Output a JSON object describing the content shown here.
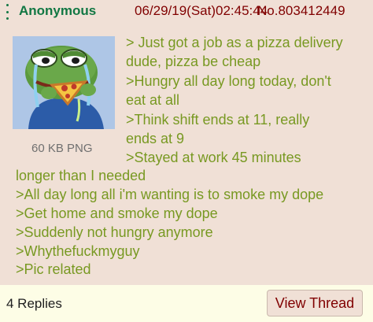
{
  "post": {
    "name": "Anonymous",
    "datetime": "06/29/19(Sat)02:45:44",
    "post_number": "No.803412449",
    "file_info": "60 KB PNG",
    "lines": [
      "> Just got a job as a pizza delivery",
      "dude, pizza be cheap",
      ">Hungry all day long today, don't",
      "eat at all",
      ">Think shift ends at 11, really",
      "ends at 9",
      ">Stayed at work 45 minutes",
      "longer than I needed",
      ">All day long all i'm wanting is to smoke my dope",
      ">Get home and smoke my dope",
      ">Suddenly not hungry anymore",
      ">Whythefuckmyguy",
      ">Pic related"
    ]
  },
  "footer": {
    "replies": "4 Replies",
    "view_thread": "View Thread"
  },
  "colors": {
    "post_bg": "#f0e0d6",
    "page_bg": "#fdfde6",
    "name": "#117743",
    "greentext": "#789922",
    "meta": "#800000"
  },
  "icons": {
    "menu": "vertical-dots-icon"
  }
}
